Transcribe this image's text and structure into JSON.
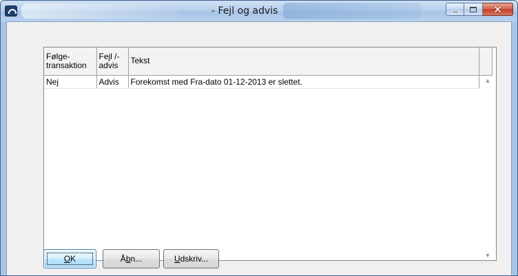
{
  "window": {
    "title": "- Fejl og advis",
    "controls": {
      "minimize_icon": "minimize-icon",
      "maximize_icon": "maximize-icon",
      "close_icon": "close-icon"
    }
  },
  "grid": {
    "columns": [
      {
        "line1": "Følge-",
        "line2": "transaktion"
      },
      {
        "line1": "Fejl /-",
        "line2": "advis"
      },
      {
        "line1": "Tekst",
        "line2": ""
      }
    ],
    "rows": [
      {
        "folgetransaktion": "Nej",
        "fejl_advis": "Advis",
        "tekst": "Forekomst med Fra-dato 01-12-2013 er slettet."
      }
    ]
  },
  "buttons": {
    "ok": {
      "mnemonic": "O",
      "rest": "K"
    },
    "open": {
      "pre": "Å",
      "mnemonic": "b",
      "rest": "n..."
    },
    "print": {
      "mnemonic": "U",
      "rest": "dskriv..."
    }
  },
  "colors": {
    "title_bar": "#b8d1ec",
    "close_button": "#c0402a",
    "dialog_bg": "#f0f0f0"
  }
}
